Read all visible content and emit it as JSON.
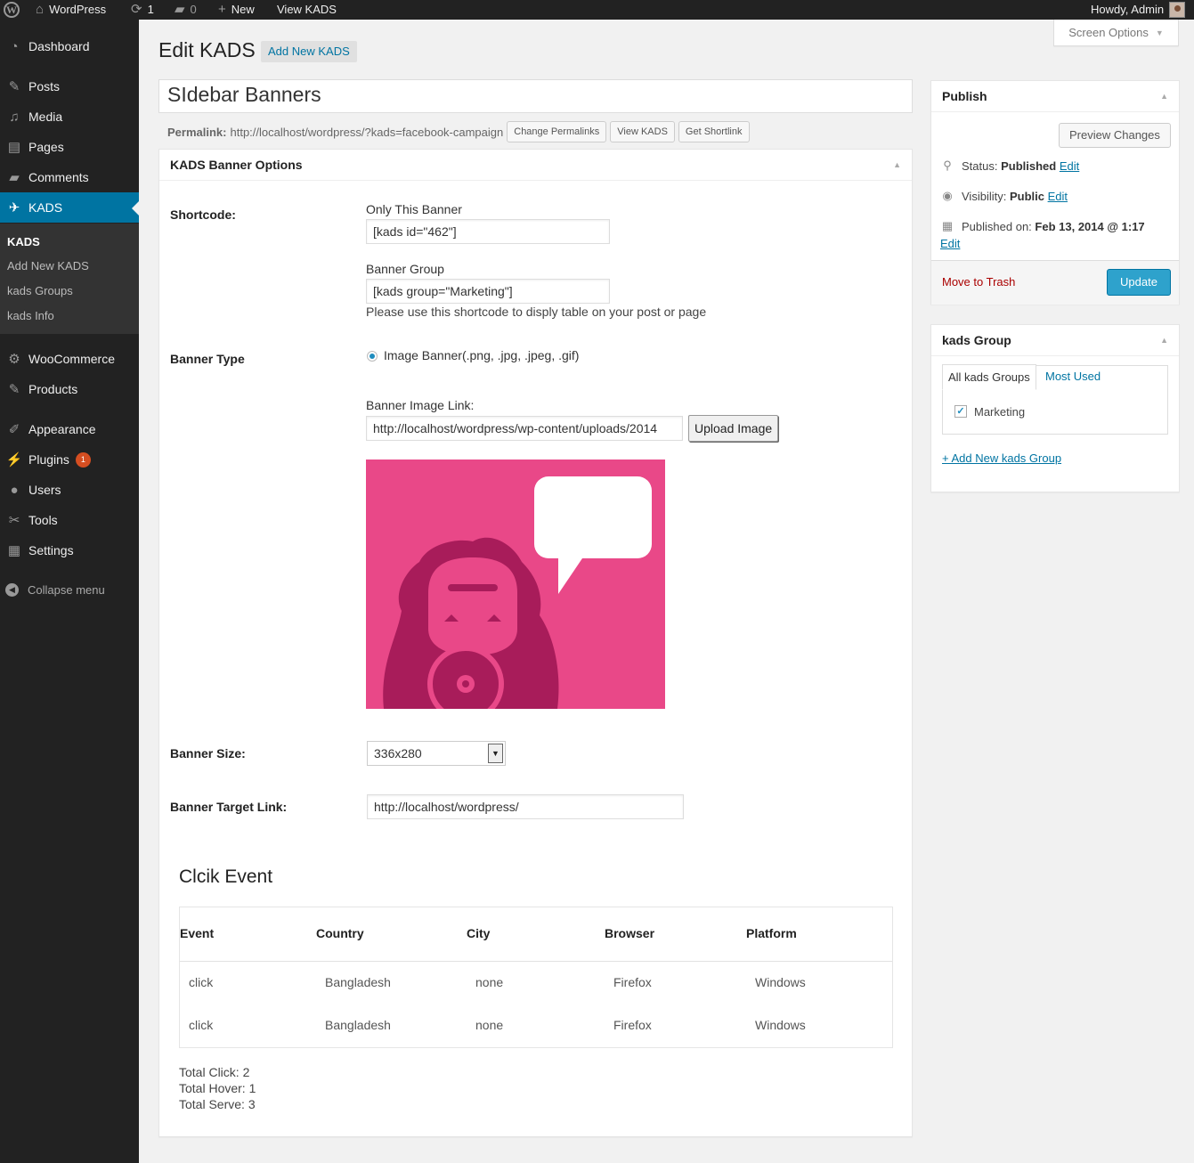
{
  "admin_bar": {
    "logo": "W",
    "site_name": "WordPress",
    "updates_count": "1",
    "comments_count": "0",
    "new_label": "New",
    "view_label": "View KADS",
    "howdy": "Howdy, Admin"
  },
  "sidebar": {
    "items": [
      {
        "label": "Dashboard",
        "icon": "dashboard-icon"
      },
      {
        "label": "Posts",
        "icon": "pin-icon"
      },
      {
        "label": "Media",
        "icon": "media-icon"
      },
      {
        "label": "Pages",
        "icon": "pages-icon"
      },
      {
        "label": "Comments",
        "icon": "comment-icon"
      },
      {
        "label": "KADS",
        "icon": "megaphone-icon"
      },
      {
        "label": "WooCommerce",
        "icon": "gear-icon"
      },
      {
        "label": "Products",
        "icon": "pin-icon"
      },
      {
        "label": "Appearance",
        "icon": "brush-icon"
      },
      {
        "label": "Plugins",
        "icon": "plug-icon"
      },
      {
        "label": "Users",
        "icon": "user-icon"
      },
      {
        "label": "Tools",
        "icon": "wrench-icon"
      },
      {
        "label": "Settings",
        "icon": "settings-icon"
      }
    ],
    "plugins_badge": "1",
    "submenu": [
      "KADS",
      "Add New KADS",
      "kads Groups",
      "kads Info"
    ],
    "collapse": "Collapse menu"
  },
  "screen_options": "Screen Options",
  "heading": {
    "title": "Edit KADS",
    "add_new": "Add New KADS"
  },
  "post_title": "SIdebar Banners",
  "permalink": {
    "label": "Permalink:",
    "url": "http://localhost/wordpress/?kads=facebook-campaign",
    "buttons": [
      "Change Permalinks",
      "View KADS",
      "Get Shortlink"
    ]
  },
  "options_box": {
    "title": "KADS Banner Options",
    "shortcode_label": "Shortcode:",
    "only_banner_label": "Only This Banner",
    "only_banner_value": "[kads id=\"462\"]",
    "group_label": "Banner Group",
    "group_value": "[kads group=\"Marketing\"]",
    "help": "Please use this shortcode to disply table on your post or page",
    "banner_type_label": "Banner Type",
    "banner_type_option": "Image Banner(.png, .jpg, .jpeg, .gif)",
    "image_link_label": "Banner Image Link:",
    "image_link_value": "http://localhost/wordpress/wp-content/uploads/2014",
    "upload_button": "Upload Image",
    "banner_size_label": "Banner Size:",
    "banner_size_value": "336x280",
    "target_link_label": "Banner Target Link:",
    "target_link_value": "http://localhost/wordpress/"
  },
  "events": {
    "title": "Clcik Event",
    "headers": [
      "Event",
      "Country",
      "City",
      "Browser",
      "Platform"
    ],
    "rows": [
      [
        "click",
        "Bangladesh",
        "none",
        "Firefox",
        "Windows"
      ],
      [
        "click",
        "Bangladesh",
        "none",
        "Firefox",
        "Windows"
      ]
    ],
    "totals": [
      "Total Click: 2",
      "Total Hover: 1",
      "Total Serve: 3"
    ]
  },
  "publish": {
    "title": "Publish",
    "preview": "Preview Changes",
    "status_label": "Status:",
    "status_value": "Published",
    "visibility_label": "Visibility:",
    "visibility_value": "Public",
    "published_label": "Published on:",
    "published_value": "Feb 13, 2014 @ 1:17",
    "edit": "Edit",
    "trash": "Move to Trash",
    "update": "Update"
  },
  "group_box": {
    "title": "kads Group",
    "tab_all": "All kads Groups",
    "tab_used": "Most Used",
    "group_item": "Marketing",
    "add_new": "+ Add New kads Group"
  },
  "colors": {
    "accent": "#0074a2",
    "banner_bg": "#e94888",
    "banner_fg": "#a81c5a"
  }
}
